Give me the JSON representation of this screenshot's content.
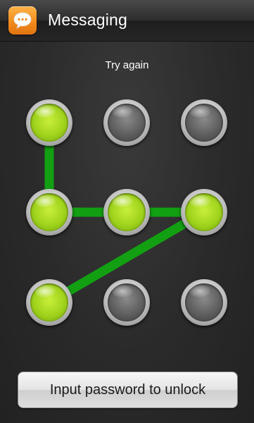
{
  "header": {
    "title": "Messaging",
    "app_icon": "chat-bubble-icon",
    "app_icon_color": "#f28a1b"
  },
  "status": {
    "text": "Try again"
  },
  "pattern": {
    "line_color": "#12a012",
    "active_color": "#9fd21c",
    "inactive_color": "#5a5a5a",
    "grid": [
      [
        true,
        false,
        false
      ],
      [
        true,
        true,
        true
      ],
      [
        true,
        false,
        false
      ]
    ],
    "sequence": [
      [
        0,
        0
      ],
      [
        1,
        0
      ],
      [
        1,
        1
      ],
      [
        1,
        2
      ],
      [
        2,
        0
      ]
    ]
  },
  "unlock_button": {
    "label": "Input password to unlock"
  }
}
